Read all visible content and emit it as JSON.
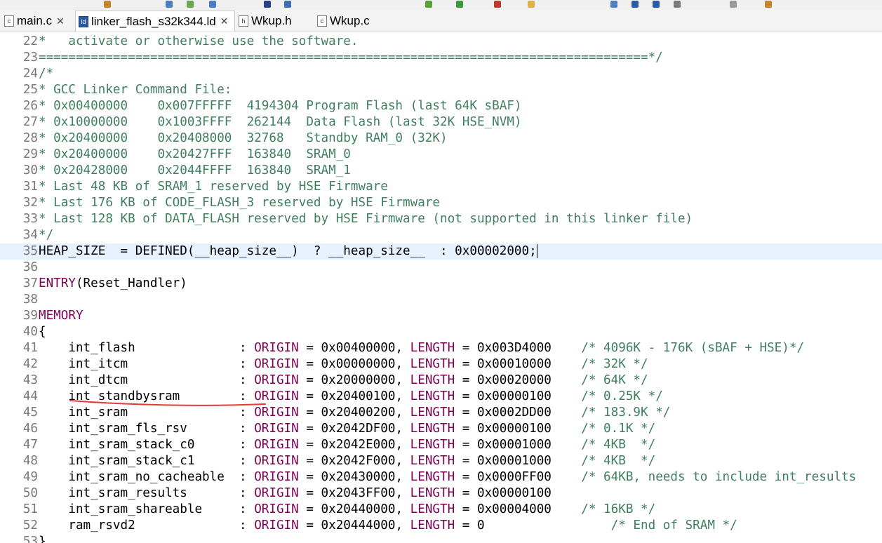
{
  "tabs": [
    {
      "name": "main.c",
      "icon": "c-file-icon",
      "active": false,
      "close": "✕"
    },
    {
      "name": "linker_flash_s32k344.ld",
      "icon": "linker-file-icon",
      "active": true,
      "close": "✕"
    },
    {
      "name": "Wkup.h",
      "icon": "h-file-icon",
      "active": false
    },
    {
      "name": "Wkup.c",
      "icon": "c-file-icon",
      "active": false
    }
  ],
  "editor": {
    "current_line": 35,
    "annotation": {
      "type": "red-underline",
      "line": 44,
      "color": "#e53935"
    },
    "lines": [
      {
        "n": "22",
        "segs": [
          [
            "c",
            "*   activate or otherwise use the software."
          ]
        ]
      },
      {
        "n": "23",
        "segs": [
          [
            "c",
            "==================================================================================*/"
          ]
        ]
      },
      {
        "n": "24",
        "segs": [
          [
            "c",
            "/*"
          ]
        ]
      },
      {
        "n": "25",
        "segs": [
          [
            "c",
            "* GCC Linker Command File:"
          ]
        ]
      },
      {
        "n": "26",
        "segs": [
          [
            "c",
            "* 0x00400000    0x007FFFFF  4194304 Program Flash (last 64K sBAF)"
          ]
        ]
      },
      {
        "n": "27",
        "segs": [
          [
            "c",
            "* 0x10000000    0x1003FFFF  262144  Data Flash (last 32K HSE_NVM)"
          ]
        ]
      },
      {
        "n": "28",
        "segs": [
          [
            "c",
            "* 0x20400000    0x20408000  32768   Standby RAM_0 (32K)"
          ]
        ]
      },
      {
        "n": "29",
        "segs": [
          [
            "c",
            "* 0x20400000    0x20427FFF  163840  SRAM_0"
          ]
        ]
      },
      {
        "n": "30",
        "segs": [
          [
            "c",
            "* 0x20428000    0x2044FFFF  163840  SRAM_1"
          ]
        ]
      },
      {
        "n": "31",
        "segs": [
          [
            "c",
            "* Last 48 KB of SRAM_1 reserved by HSE Firmware"
          ]
        ]
      },
      {
        "n": "32",
        "segs": [
          [
            "c",
            "* Last 176 KB of CODE_FLASH_3 reserved by HSE Firmware"
          ]
        ]
      },
      {
        "n": "33",
        "segs": [
          [
            "c",
            "* Last 128 KB of DATA_FLASH reserved by HSE Firmware (not supported in this linker file)"
          ]
        ]
      },
      {
        "n": "34",
        "segs": [
          [
            "c",
            "*/"
          ]
        ]
      },
      {
        "n": "35",
        "segs": [
          [
            "p",
            "HEAP_SIZE  = DEFINED(__heap_size__)  ? __heap_size__  : 0x00002000;"
          ]
        ]
      },
      {
        "n": "36",
        "segs": []
      },
      {
        "n": "37",
        "segs": [
          [
            "k",
            "ENTRY"
          ],
          [
            "p",
            "(Reset_Handler)"
          ]
        ]
      },
      {
        "n": "38",
        "segs": []
      },
      {
        "n": "39",
        "segs": [
          [
            "k",
            "MEMORY"
          ]
        ]
      },
      {
        "n": "40",
        "segs": [
          [
            "p",
            "{"
          ]
        ]
      },
      {
        "n": "41",
        "segs": [
          [
            "p",
            "    int_flash              : "
          ],
          [
            "o",
            "ORIGIN"
          ],
          [
            "p",
            " = 0x00400000, "
          ],
          [
            "o",
            "LENGTH"
          ],
          [
            "p",
            " = 0x003D4000    "
          ],
          [
            "c",
            "/* 4096K - 176K (sBAF + HSE)*/"
          ]
        ]
      },
      {
        "n": "42",
        "segs": [
          [
            "p",
            "    int_itcm               : "
          ],
          [
            "o",
            "ORIGIN"
          ],
          [
            "p",
            " = 0x00000000, "
          ],
          [
            "o",
            "LENGTH"
          ],
          [
            "p",
            " = 0x00010000    "
          ],
          [
            "c",
            "/* 32K */"
          ]
        ]
      },
      {
        "n": "43",
        "segs": [
          [
            "p",
            "    int_dtcm               : "
          ],
          [
            "o",
            "ORIGIN"
          ],
          [
            "p",
            " = 0x20000000, "
          ],
          [
            "o",
            "LENGTH"
          ],
          [
            "p",
            " = 0x00020000    "
          ],
          [
            "c",
            "/* 64K */"
          ]
        ]
      },
      {
        "n": "44",
        "segs": [
          [
            "p",
            "    int_standbysram        : "
          ],
          [
            "o",
            "ORIGIN"
          ],
          [
            "p",
            " = 0x20400100, "
          ],
          [
            "o",
            "LENGTH"
          ],
          [
            "p",
            " = 0x00000100    "
          ],
          [
            "c",
            "/* 0.25K */"
          ]
        ]
      },
      {
        "n": "45",
        "segs": [
          [
            "p",
            "    int_sram               : "
          ],
          [
            "o",
            "ORIGIN"
          ],
          [
            "p",
            " = 0x20400200, "
          ],
          [
            "o",
            "LENGTH"
          ],
          [
            "p",
            " = 0x0002DD00    "
          ],
          [
            "c",
            "/* 183.9K */"
          ]
        ]
      },
      {
        "n": "46",
        "segs": [
          [
            "p",
            "    int_sram_fls_rsv       : "
          ],
          [
            "o",
            "ORIGIN"
          ],
          [
            "p",
            " = 0x2042DF00, "
          ],
          [
            "o",
            "LENGTH"
          ],
          [
            "p",
            " = 0x00000100    "
          ],
          [
            "c",
            "/* 0.1K */"
          ]
        ]
      },
      {
        "n": "47",
        "segs": [
          [
            "p",
            "    int_sram_stack_c0      : "
          ],
          [
            "o",
            "ORIGIN"
          ],
          [
            "p",
            " = 0x2042E000, "
          ],
          [
            "o",
            "LENGTH"
          ],
          [
            "p",
            " = 0x00001000    "
          ],
          [
            "c",
            "/* 4KB  */"
          ]
        ]
      },
      {
        "n": "48",
        "segs": [
          [
            "p",
            "    int_sram_stack_c1      : "
          ],
          [
            "o",
            "ORIGIN"
          ],
          [
            "p",
            " = 0x2042F000, "
          ],
          [
            "o",
            "LENGTH"
          ],
          [
            "p",
            " = 0x00001000    "
          ],
          [
            "c",
            "/* 4KB  */"
          ]
        ]
      },
      {
        "n": "49",
        "segs": [
          [
            "p",
            "    int_sram_no_cacheable  : "
          ],
          [
            "o",
            "ORIGIN"
          ],
          [
            "p",
            " = 0x20430000, "
          ],
          [
            "o",
            "LENGTH"
          ],
          [
            "p",
            " = 0x0000FF00    "
          ],
          [
            "c",
            "/* 64KB, needs to include int_results"
          ]
        ]
      },
      {
        "n": "50",
        "segs": [
          [
            "p",
            "    int_sram_results       : "
          ],
          [
            "o",
            "ORIGIN"
          ],
          [
            "p",
            " = 0x2043FF00, "
          ],
          [
            "o",
            "LENGTH"
          ],
          [
            "p",
            " = 0x00000100"
          ]
        ]
      },
      {
        "n": "51",
        "segs": [
          [
            "p",
            "    int_sram_shareable     : "
          ],
          [
            "o",
            "ORIGIN"
          ],
          [
            "p",
            " = 0x20440000, "
          ],
          [
            "o",
            "LENGTH"
          ],
          [
            "p",
            " = 0x00004000    "
          ],
          [
            "c",
            "/* 16KB */"
          ]
        ]
      },
      {
        "n": "52",
        "segs": [
          [
            "p",
            "    ram_rsvd2              : "
          ],
          [
            "o",
            "ORIGIN"
          ],
          [
            "p",
            " = 0x20444000, "
          ],
          [
            "o",
            "LENGTH"
          ],
          [
            "p",
            " = 0                 "
          ],
          [
            "c",
            "/* End of SRAM */"
          ]
        ]
      },
      {
        "n": "53",
        "segs": [
          [
            "p",
            "}"
          ]
        ]
      }
    ]
  },
  "colors": {
    "comment": "#3f7f5f",
    "keyword": "#7f0055",
    "current_line": "#e8f2fe",
    "annotation": "#e53935"
  }
}
